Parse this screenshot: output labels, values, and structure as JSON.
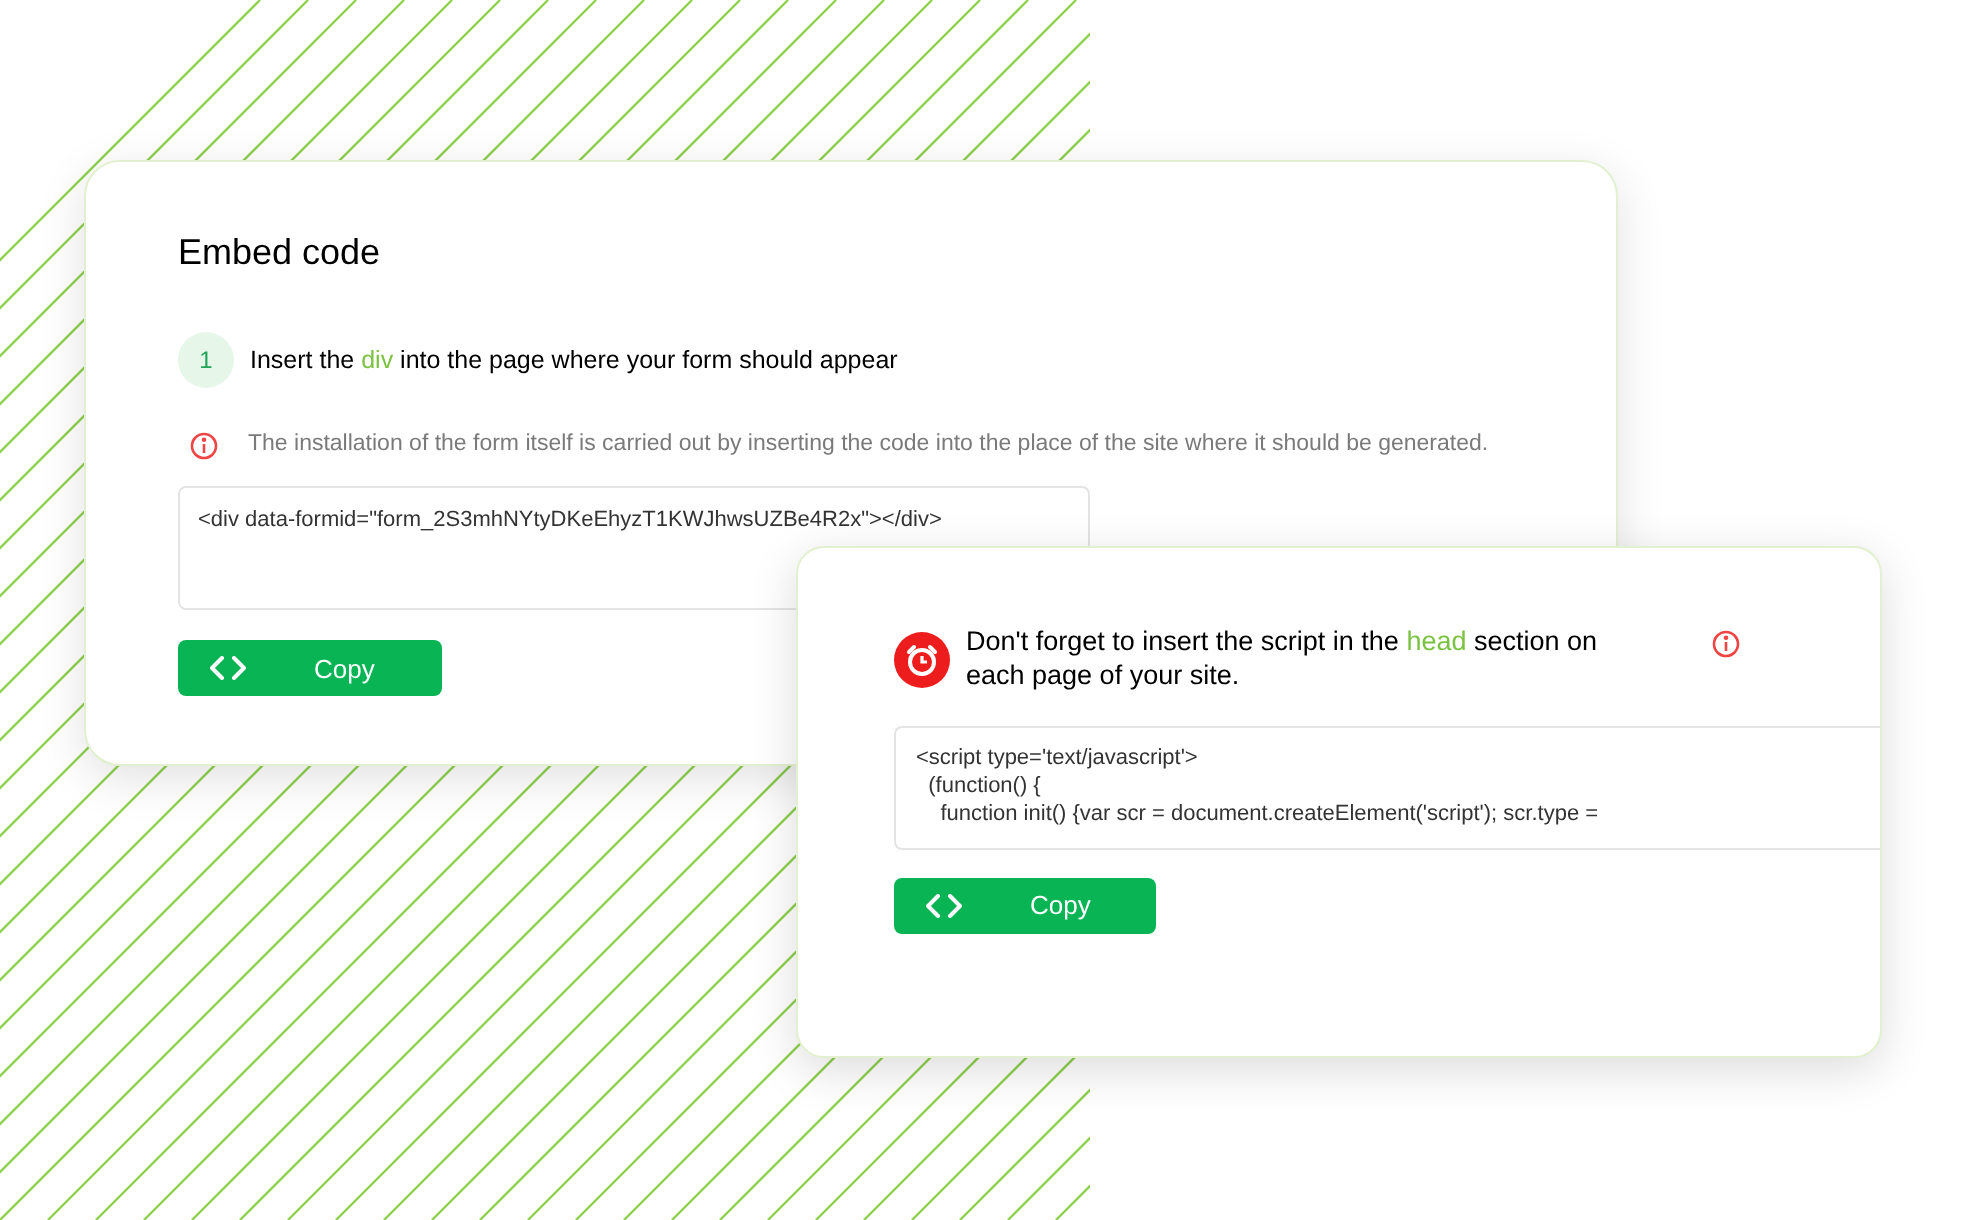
{
  "embed_card": {
    "title": "Embed code",
    "step": {
      "number": "1",
      "text_before": "Insert the ",
      "highlight": "div",
      "text_after": " into the page where your form should appear"
    },
    "note": "The installation of the form itself is carried out by inserting the code into the place of the site where it should be generated.",
    "code": "<div data-formid=\"form_2S3mhNYtyDKeEhyzT1KWJhwsUZBe4R2x\"></div>",
    "button": "Copy"
  },
  "script_card": {
    "message": {
      "text_before": "Don't forget to insert the script in the ",
      "highlight": "head",
      "text_after": " section on each page of your site."
    },
    "code": "<script type='text/javascript'>\n  (function() {\n    function init() {var scr = document.createElement('script'); scr.type =",
    "button": "Copy"
  }
}
